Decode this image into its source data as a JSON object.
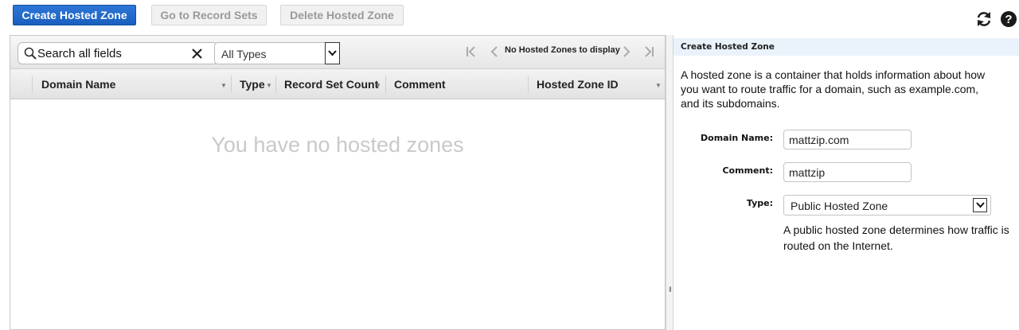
{
  "toolbar": {
    "create_label": "Create Hosted Zone",
    "goto_label": "Go to Record Sets",
    "delete_label": "Delete Hosted Zone",
    "icons": [
      "refresh-icon",
      "help-icon"
    ]
  },
  "filter": {
    "search_placeholder": "Search all fields",
    "type_selected": "All Types",
    "pager_text": "No Hosted Zones to display"
  },
  "table": {
    "columns": [
      "Domain Name",
      "Type",
      "Record Set Count",
      "Comment",
      "Hosted Zone ID"
    ],
    "empty_message": "You have no hosted zones"
  },
  "panel": {
    "title": "Create Hosted Zone",
    "description": "A hosted zone is a container that holds information about how you want to route traffic for a domain, such as example.com, and its subdomains.",
    "domain_label": "Domain Name:",
    "domain_value": "mattzip.com",
    "comment_label": "Comment:",
    "comment_value": "mattzip",
    "type_label": "Type:",
    "type_value": "Public Hosted Zone",
    "type_help": "A public hosted zone determines how traffic is routed on the Internet."
  },
  "colors": {
    "primary": "#1a5fbf",
    "panel_title_bg": "#eaf2fb",
    "empty_text": "#c9c9c9"
  }
}
